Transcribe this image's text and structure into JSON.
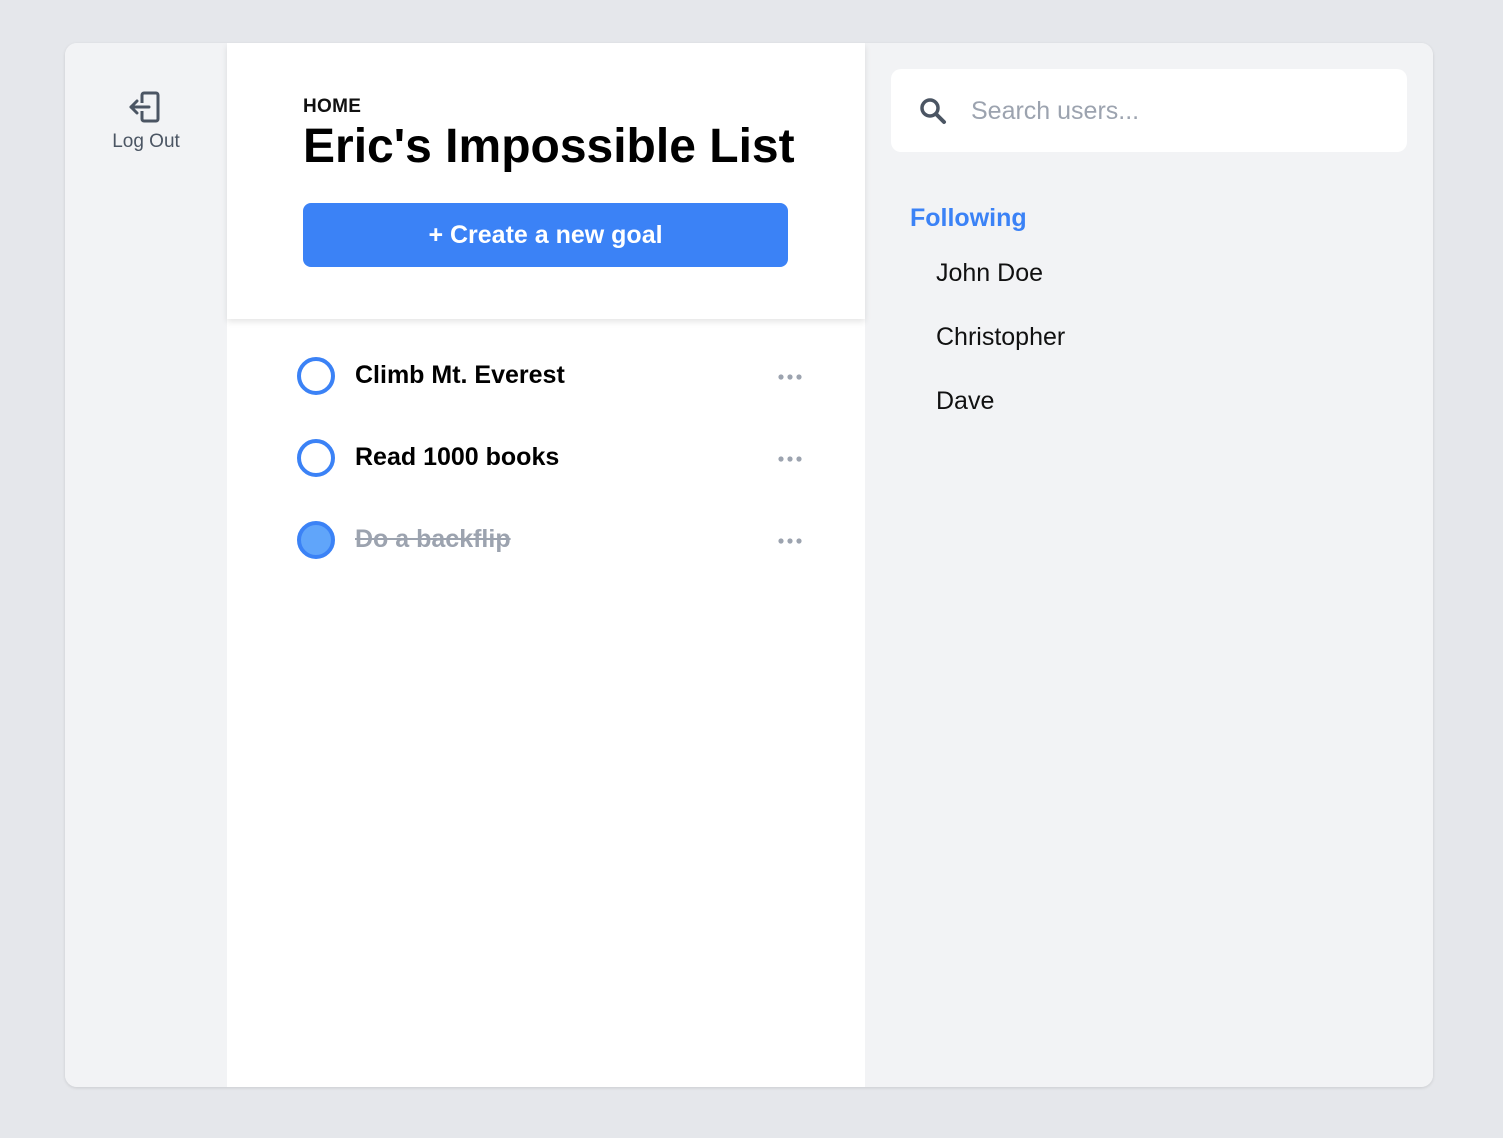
{
  "nav": {
    "logout_label": "Log Out",
    "logout_icon": "logout-icon"
  },
  "header": {
    "breadcrumb": "HOME",
    "title": "Eric's Impossible List",
    "create_button_label": "+ Create a new goal",
    "accent_color": "#3b82f6"
  },
  "goals": [
    {
      "title": "Climb Mt. Everest",
      "completed": false
    },
    {
      "title": "Read 1000 books",
      "completed": false
    },
    {
      "title": "Do a backflip",
      "completed": true
    }
  ],
  "search": {
    "placeholder": "Search users...",
    "value": "",
    "icon": "search-icon"
  },
  "following": {
    "title": "Following",
    "users": [
      "John Doe",
      "Christopher",
      "Dave"
    ]
  }
}
